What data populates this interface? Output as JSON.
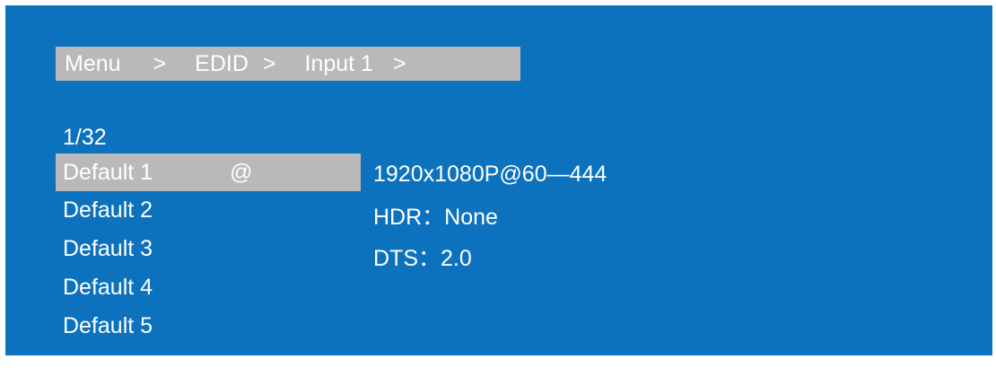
{
  "colors": {
    "screen_bg": "#0d72bd",
    "highlight_bg": "#b9b9b9",
    "text": "#ffffff"
  },
  "breadcrumb": {
    "items": [
      "Menu",
      "EDID",
      "Input 1"
    ],
    "separator": ">"
  },
  "page_counter": "1/32",
  "list": {
    "items": [
      {
        "label": "Default 1",
        "marker": "@",
        "selected": true
      },
      {
        "label": "Default 2",
        "marker": "",
        "selected": false
      },
      {
        "label": "Default 3",
        "marker": "",
        "selected": false
      },
      {
        "label": "Default 4",
        "marker": "",
        "selected": false
      },
      {
        "label": "Default 5",
        "marker": "",
        "selected": false
      }
    ]
  },
  "details": {
    "resolution": "1920x1080P@60—444",
    "hdr": "HDR：None",
    "dts": "DTS：2.0"
  }
}
